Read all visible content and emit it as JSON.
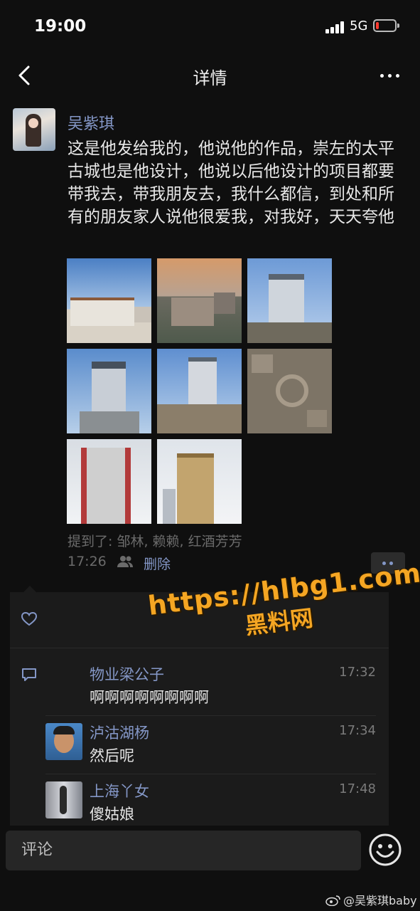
{
  "status_bar": {
    "time": "19:00",
    "network": "5G"
  },
  "nav": {
    "title": "详情"
  },
  "post": {
    "author": "吴紫琪",
    "text": "这是他发给我的，他说他的作品，崇左的太平古城也是他设计，他说以后他设计的项目都要带我去，带我朋友去，我什么都信，到处和所有的朋友家人说他很爱我，对我好，天天夸他",
    "mention_label": "提到了: 邹林, 赖赖, 红酒芳芳",
    "time": "17:26",
    "delete_label": "删除",
    "photo_count": 8
  },
  "comments": [
    {
      "name": "物业梁公子",
      "time": "17:32",
      "text": "啊啊啊啊啊啊啊啊"
    },
    {
      "name": "泸沽湖杨",
      "time": "17:34",
      "text": "然后呢"
    },
    {
      "name": "上海丫女",
      "time": "17:48",
      "text": "傻姑娘"
    }
  ],
  "watermark": {
    "url": "https://hlbg1.com",
    "name": "黑料网"
  },
  "comment_input": {
    "placeholder": "评论"
  },
  "footer_watermark": "@吴紫琪baby",
  "icons": [
    "back-arrow-icon",
    "more-dots-icon",
    "friends-icon",
    "heart-icon",
    "comment-bubble-icon",
    "emoji-icon",
    "weibo-logo-icon"
  ],
  "colors": {
    "link": "#8497c7",
    "watermark": "#f5a623",
    "battery_low": "#ff3b30"
  }
}
